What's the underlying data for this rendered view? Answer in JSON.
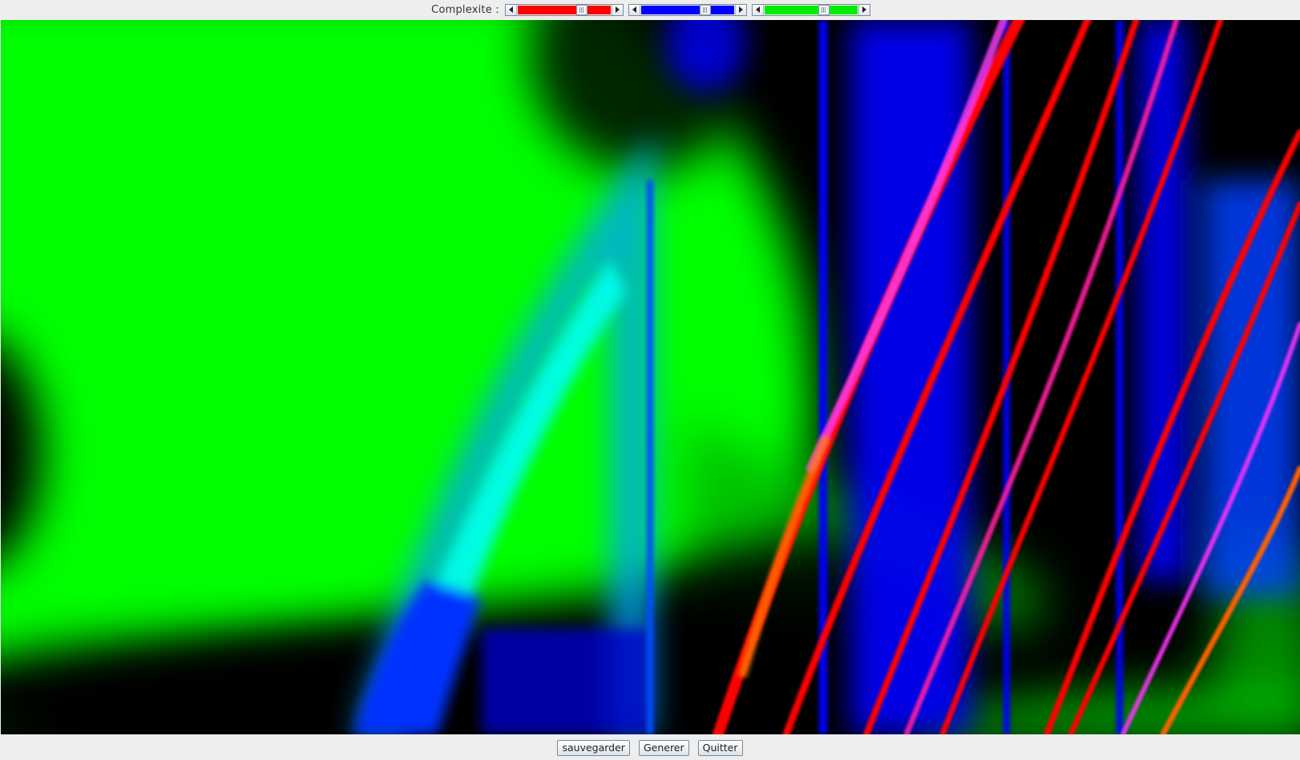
{
  "toolbar": {
    "complexity_label": "Complexite :",
    "sliders": [
      {
        "color": "#ff0000",
        "value": 0.72
      },
      {
        "color": "#0000ff",
        "value": 0.72
      },
      {
        "color": "#00ee00",
        "value": 0.66
      }
    ]
  },
  "canvas": {
    "description_colors": {
      "green": "#00ff00",
      "blue": "#0000ff",
      "red": "#ff0000",
      "black": "#000000"
    }
  },
  "buttons": {
    "save_label": "sauvegarder",
    "generate_label": "Generer",
    "quit_label": "Quitter"
  }
}
